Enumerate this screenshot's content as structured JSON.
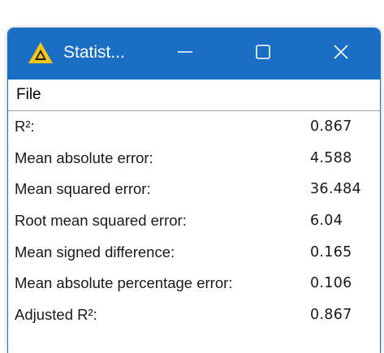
{
  "window": {
    "title": "Statist...",
    "accent_color": "#1a6fc4",
    "icon": "knime-triangle-icon"
  },
  "titlebar": {
    "minimize_icon": "minimize-icon",
    "maximize_icon": "maximize-icon",
    "close_icon": "close-icon"
  },
  "menu": {
    "items": [
      {
        "label": "File"
      }
    ]
  },
  "stats": {
    "rows": [
      {
        "label": "R²:",
        "value": "0.867"
      },
      {
        "label": "Mean absolute error:",
        "value": "4.588"
      },
      {
        "label": "Mean squared error:",
        "value": "36.484"
      },
      {
        "label": "Root mean squared error:",
        "value": "6.04"
      },
      {
        "label": "Mean signed difference:",
        "value": "0.165"
      },
      {
        "label": "Mean absolute percentage error:",
        "value": "0.106"
      },
      {
        "label": "Adjusted R²:",
        "value": "0.867"
      }
    ]
  }
}
